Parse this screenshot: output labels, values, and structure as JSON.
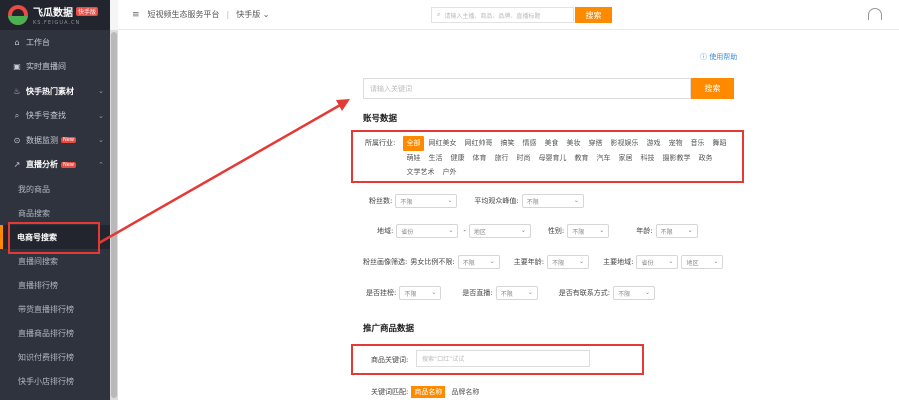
{
  "logo": {
    "name": "飞瓜数据",
    "badge": "快手版",
    "domain": "KS.FEIGUA.CN"
  },
  "sidebar": {
    "items": [
      {
        "icon": "home-icon",
        "glyph": "⌂",
        "label": "工作台",
        "bold": false,
        "chev": false,
        "badge": ""
      },
      {
        "icon": "live-screen-icon",
        "glyph": "▣",
        "label": "实时直播间",
        "bold": false,
        "chev": false,
        "badge": ""
      },
      {
        "icon": "fire-icon",
        "glyph": "♨",
        "label": "快手热门素材",
        "bold": true,
        "chev": true,
        "badge": ""
      },
      {
        "icon": "search-user-icon",
        "glyph": "⌕",
        "label": "快手号查找",
        "bold": false,
        "chev": true,
        "badge": ""
      },
      {
        "icon": "monitor-icon",
        "glyph": "⊙",
        "label": "数据监测",
        "bold": false,
        "chev": true,
        "badge": "New"
      },
      {
        "icon": "analysis-icon",
        "glyph": "↗",
        "label": "直播分析",
        "bold": true,
        "chev": true,
        "badge": "New"
      }
    ],
    "subitems": [
      "我的商品",
      "商品搜索",
      "电商号搜索",
      "直播间搜索",
      "直播排行榜",
      "带货直播排行榜",
      "直播商品排行榜",
      "知识付费排行榜",
      "快手小店排行榜"
    ],
    "active_sub": "电商号搜索",
    "chev_glyph": "⌄",
    "chev_up_glyph": "⌃"
  },
  "topbar": {
    "menu_glyph": "≡",
    "platform": "短视频生态服务平台",
    "sep": "|",
    "switch": "快手版",
    "search_placeholder": "请输入主播、商品、品牌、直播标题",
    "search_btn": "搜索"
  },
  "main": {
    "help": "使用帮助",
    "keyword_placeholder": "请输入关键词",
    "search_btn": "搜索",
    "account_title": "账号数据",
    "industry_label": "所属行业:",
    "industries": [
      "全部",
      "网红美女",
      "网红帅哥",
      "搞笑",
      "情感",
      "美食",
      "美妆",
      "穿搭",
      "影视娱乐",
      "游戏",
      "宠物",
      "音乐",
      "舞蹈",
      "萌娃",
      "生活",
      "健康",
      "体育",
      "旅行",
      "时尚",
      "母婴育儿",
      "教育",
      "汽车",
      "家居",
      "科技",
      "摄影教学",
      "政务",
      "文学艺术",
      "户外"
    ],
    "fans_label": "粉丝数:",
    "fans_val": "不限",
    "avg_view_label": "平均观众峰值:",
    "avg_view_val": "不限",
    "region_label": "地域:",
    "province": "省份",
    "dash": "-",
    "area": "地区",
    "gender_label": "性别:",
    "gender_val": "不限",
    "age_label": "年龄:",
    "age_val": "不限",
    "portrait_label": "粉丝画像筛选:",
    "ratio_label": "男女比例不限:",
    "ratio_val": "不限",
    "main_age_label": "主要年龄:",
    "main_age_val": "不限",
    "main_region_label": "主要地域:",
    "main_province": "省份",
    "main_area": "地区",
    "hang_label": "是否挂榜:",
    "hang_val": "不限",
    "live_label": "是否直播:",
    "live_val": "不限",
    "contact_label": "是否有联系方式:",
    "contact_val": "不限",
    "promo_title": "推广商品数据",
    "pkw_label": "商品关键词:",
    "pkw_placeholder": "搜索“口红”试试",
    "match_label": "关键词匹配:",
    "match_opts": [
      "商品名称",
      "品牌名称"
    ]
  },
  "colors": {
    "accent": "#ff8a00",
    "highlight": "#e53935",
    "sidebar": "#2f333e"
  }
}
